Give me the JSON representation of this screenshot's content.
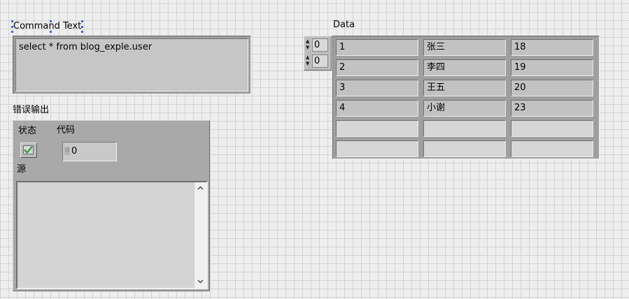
{
  "command_text": {
    "label": "Command Text",
    "value": "select * from blog_exple.user"
  },
  "error_out": {
    "label": "错误输出",
    "status_label": "状态",
    "code_label": "代码",
    "code_radix": "d",
    "code_value": "0",
    "source_label": "源",
    "source_value": "",
    "status_icon": "checkmark-icon",
    "status_color": "#2e9c2e"
  },
  "data": {
    "label": "Data",
    "row_index": "0",
    "col_index": "0",
    "rows": [
      [
        "1",
        "张三",
        "18"
      ],
      [
        "2",
        "李四",
        "19"
      ],
      [
        "3",
        "王五",
        "20"
      ],
      [
        "4",
        "小谢",
        "23"
      ],
      [
        "",
        "",
        ""
      ],
      [
        "",
        "",
        ""
      ]
    ]
  },
  "scroll": {
    "up_icon": "chevron-up-icon",
    "down_icon": "chevron-down-icon"
  }
}
